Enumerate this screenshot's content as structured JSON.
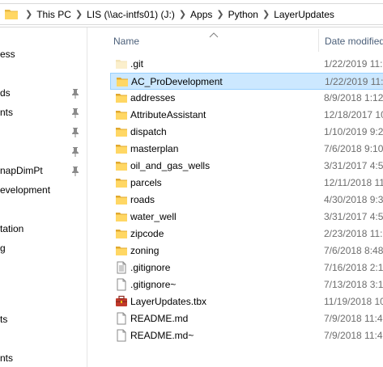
{
  "address_bar": {
    "crumbs": [
      "This PC",
      "LIS (\\\\ac-intfs01) (J:)",
      "Apps",
      "Python",
      "LayerUpdates"
    ]
  },
  "nav_pane": {
    "items": [
      {
        "label": "ess",
        "pinned": false
      },
      {
        "label": "ds",
        "pinned": true
      },
      {
        "label": "nts",
        "pinned": true
      },
      {
        "label": "",
        "pinned": true
      },
      {
        "label": "",
        "pinned": true
      },
      {
        "label": "napDimPt",
        "pinned": true
      },
      {
        "label": "evelopment",
        "pinned": false
      },
      {
        "label": "tation",
        "pinned": false
      },
      {
        "label": "g",
        "pinned": false
      },
      {
        "label": "ts",
        "pinned": false
      },
      {
        "label": "nts",
        "pinned": false
      }
    ]
  },
  "columns": {
    "name": "Name",
    "date_modified": "Date modified"
  },
  "files": [
    {
      "name": ".git",
      "date": "1/22/2019 11:5",
      "type": "folder-faded",
      "selected": false
    },
    {
      "name": "AC_ProDevelopment",
      "date": "1/22/2019 11:4",
      "type": "folder",
      "selected": true
    },
    {
      "name": "addresses",
      "date": "8/9/2018 1:12",
      "type": "folder",
      "selected": false
    },
    {
      "name": "AttributeAssistant",
      "date": "12/18/2017 10",
      "type": "folder",
      "selected": false
    },
    {
      "name": "dispatch",
      "date": "1/10/2019 9:2",
      "type": "folder",
      "selected": false
    },
    {
      "name": "masterplan",
      "date": "7/6/2018 9:10",
      "type": "folder",
      "selected": false
    },
    {
      "name": "oil_and_gas_wells",
      "date": "3/31/2017 4:5",
      "type": "folder",
      "selected": false
    },
    {
      "name": "parcels",
      "date": "12/11/2018 11",
      "type": "folder",
      "selected": false
    },
    {
      "name": "roads",
      "date": "4/30/2018 9:3",
      "type": "folder",
      "selected": false
    },
    {
      "name": "water_well",
      "date": "3/31/2017 4:5",
      "type": "folder",
      "selected": false
    },
    {
      "name": "zipcode",
      "date": "2/23/2018 11:",
      "type": "folder",
      "selected": false
    },
    {
      "name": "zoning",
      "date": "7/6/2018 8:48",
      "type": "folder",
      "selected": false
    },
    {
      "name": ".gitignore",
      "date": "7/16/2018 2:1",
      "type": "file-lines",
      "selected": false
    },
    {
      "name": ".gitignore~",
      "date": "7/13/2018 3:1",
      "type": "file",
      "selected": false
    },
    {
      "name": "LayerUpdates.tbx",
      "date": "11/19/2018 10",
      "type": "toolbox",
      "selected": false
    },
    {
      "name": "README.md",
      "date": "7/9/2018 11:4",
      "type": "file",
      "selected": false
    },
    {
      "name": "README.md~",
      "date": "7/9/2018 11:4",
      "type": "file",
      "selected": false
    }
  ],
  "colors": {
    "selection_bg": "#cce8ff",
    "selection_border": "#99d1ff",
    "folder_yellow": "#ffd764",
    "header_text": "#4c607a"
  }
}
